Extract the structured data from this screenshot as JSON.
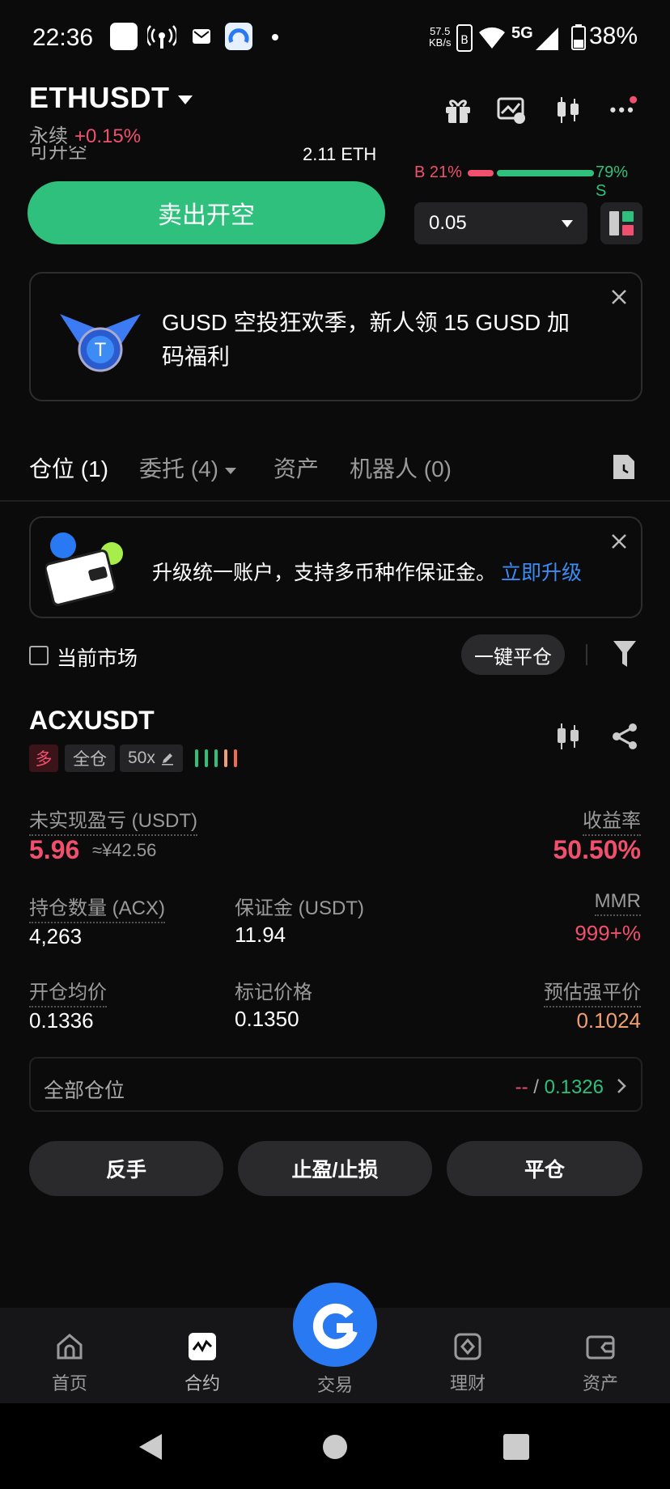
{
  "status_bar": {
    "time": "22:36",
    "net_speed": "57.5",
    "net_unit": "KB/s",
    "network": "5G",
    "battery": "38%"
  },
  "header": {
    "pair": "ETHUSDT",
    "type": "永续",
    "change": "+0.15%",
    "available_label": "可开空",
    "available_value": "2.11 ETH"
  },
  "ratio": {
    "buy": "B 21%",
    "sell": "79% S",
    "buy_fraction": 0.21
  },
  "trade": {
    "sell_button": "卖出开空",
    "amount": "0.05"
  },
  "promo": {
    "text": "GUSD 空投狂欢季，新人领 15 GUSD 加码福利"
  },
  "tabs": [
    {
      "label": "仓位 (1)"
    },
    {
      "label": "委托 (4)"
    },
    {
      "label": "资产"
    },
    {
      "label": "机器人 (0)"
    }
  ],
  "upgrade": {
    "text": "升级统一账户，支持多币种作保证金。",
    "link": "立即升级"
  },
  "filter": {
    "current_market": "当前市场",
    "close_all": "一键平仓"
  },
  "position": {
    "symbol": "ACXUSDT",
    "side": "多",
    "margin_mode": "全仓",
    "leverage": "50x",
    "pnl_label": "未实现盈亏 (USDT)",
    "pnl_value": "5.96",
    "pnl_cny": "≈¥42.56",
    "roe_label": "收益率",
    "roe_value": "50.50%",
    "qty_label": "持仓数量 (ACX)",
    "qty_value": "4,263",
    "margin_label": "保证金 (USDT)",
    "margin_value": "11.94",
    "mmr_label": "MMR",
    "mmr_value": "999+%",
    "entry_label": "开仓均价",
    "entry_value": "0.1336",
    "mark_label": "标记价格",
    "mark_value": "0.1350",
    "liq_label": "预估强平价",
    "liq_value": "0.1024",
    "all_positions_label": "全部仓位",
    "all_positions_left": "--",
    "all_positions_sep": " / ",
    "all_positions_right": "0.1326"
  },
  "actions": {
    "reverse": "反手",
    "tpsl": "止盈/止损",
    "close": "平仓"
  },
  "nav": [
    {
      "label": "首页",
      "icon": "home-icon"
    },
    {
      "label": "合约",
      "icon": "futures-icon"
    },
    {
      "label": "交易",
      "icon": "trade-icon"
    },
    {
      "label": "理财",
      "icon": "earn-icon"
    },
    {
      "label": "资产",
      "icon": "wallet-icon"
    }
  ],
  "colors": {
    "green": "#2fc07e",
    "red": "#f0506e",
    "blue": "#2979f2",
    "orange": "#f0a070"
  }
}
